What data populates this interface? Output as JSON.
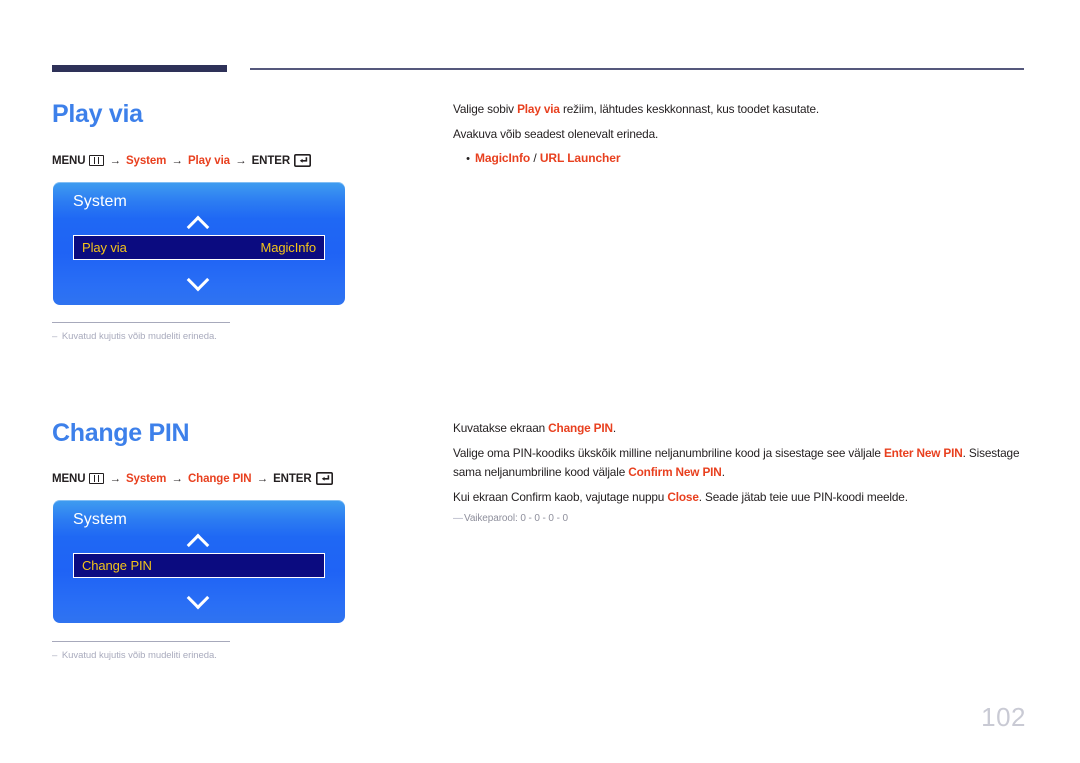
{
  "page": {
    "number": "102",
    "language": "et"
  },
  "sections": [
    {
      "id": "play-via",
      "title": "Play via",
      "menu_path": {
        "menu_label": "MENU",
        "menu_icon": "menu-grid-icon",
        "arrow": "→",
        "steps": [
          "System",
          "Play via"
        ],
        "enter_label": "ENTER",
        "enter_icon": "enter-return-icon"
      },
      "osd": {
        "title": "System",
        "up_icon": "chevron-up-icon",
        "down_icon": "chevron-down-icon",
        "row_label": "Play via",
        "row_value": "MagicInfo"
      },
      "footnote": "Kuvatud kujutis võib mudeliti erineda.",
      "footnote_dash": "–",
      "body": {
        "paragraphs": [
          {
            "parts": [
              {
                "t": "Valige sobiv ",
                "b": false
              },
              {
                "t": "Play via",
                "b": true
              },
              {
                "t": " režiim, lähtudes keskkonnast, kus toodet kasutate.",
                "b": false
              }
            ]
          },
          {
            "parts": [
              {
                "t": "Avakuva võib seadest olenevalt erineda.",
                "b": false
              }
            ]
          }
        ],
        "bullet": {
          "marker": "•",
          "left": "MagicInfo",
          "separator": " / ",
          "right": "URL Launcher"
        }
      }
    },
    {
      "id": "change-pin",
      "title": "Change PIN",
      "menu_path": {
        "menu_label": "MENU",
        "menu_icon": "menu-grid-icon",
        "arrow": "→",
        "steps": [
          "System",
          "Change PIN"
        ],
        "enter_label": "ENTER",
        "enter_icon": "enter-return-icon"
      },
      "osd": {
        "title": "System",
        "up_icon": "chevron-up-icon",
        "down_icon": "chevron-down-icon",
        "row_label": "Change PIN",
        "row_value": ""
      },
      "footnote": "Kuvatud kujutis võib mudeliti erineda.",
      "footnote_dash": "–",
      "body": {
        "paragraphs": [
          {
            "parts": [
              {
                "t": "Kuvatakse ekraan ",
                "b": false
              },
              {
                "t": "Change PIN",
                "b": true
              },
              {
                "t": ".",
                "b": false
              }
            ]
          },
          {
            "parts": [
              {
                "t": "Valige oma PIN-koodiks ükskõik milline neljanumbriline kood ja sisestage see väljale ",
                "b": false
              },
              {
                "t": "Enter New PIN",
                "b": true
              },
              {
                "t": ". Sisestage sama neljanumbriline kood väljale ",
                "b": false
              },
              {
                "t": "Confirm New PIN",
                "b": true
              },
              {
                "t": ".",
                "b": false
              }
            ]
          },
          {
            "parts": [
              {
                "t": "Kui ekraan Confirm kaob, vajutage nuppu ",
                "b": false
              },
              {
                "t": "Close",
                "b": true
              },
              {
                "t": ". Seade jätab teie uue PIN-koodi meelde.",
                "b": false
              }
            ]
          }
        ],
        "note": {
          "dash": "—",
          "text": "Vaikeparool: 0 - 0 - 0 - 0"
        }
      }
    }
  ],
  "colors": {
    "heading_blue": "#3d80ea",
    "accent_red": "#e8401f",
    "header_bar": "#2e3158",
    "osd_blue": "#1f63f5",
    "osd_row_navy": "#0b0b80",
    "osd_row_text": "#f4c419",
    "footnote_gray": "#a9abbd",
    "page_number_gray": "#c9cad4"
  }
}
